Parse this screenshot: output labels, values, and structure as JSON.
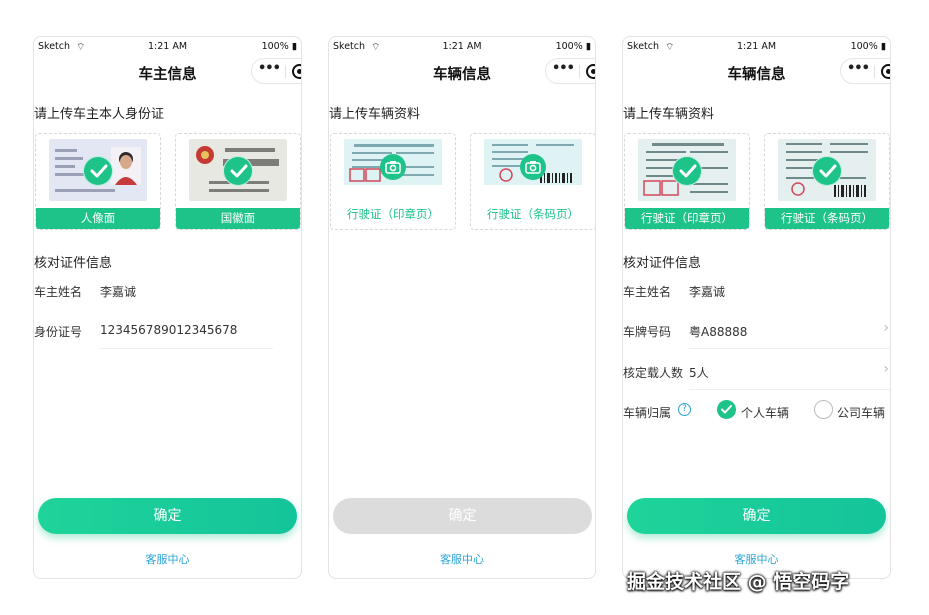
{
  "status_bar": {
    "carrier": "Sketch",
    "time": "1:21 AM",
    "battery": "100%"
  },
  "screens": [
    {
      "title": "车主信息",
      "upload_heading": "请上传车主本人身份证",
      "cards": [
        {
          "label": "人像面",
          "state": "uploaded"
        },
        {
          "label": "国徽面",
          "state": "uploaded"
        }
      ],
      "verify_heading": "核对证件信息",
      "fields": [
        {
          "label": "车主姓名",
          "value": "李嘉诚"
        },
        {
          "label": "身份证号",
          "value": "123456789012345678"
        }
      ],
      "confirm_label": "确定",
      "confirm_enabled": true,
      "service_label": "客服中心"
    },
    {
      "title": "车辆信息",
      "upload_heading": "请上传车辆资料",
      "cards": [
        {
          "label": "行驶证（印章页）",
          "state": "empty"
        },
        {
          "label": "行驶证（条码页）",
          "state": "empty"
        }
      ],
      "confirm_label": "确定",
      "confirm_enabled": false,
      "service_label": "客服中心"
    },
    {
      "title": "车辆信息",
      "upload_heading": "请上传车辆资料",
      "cards": [
        {
          "label": "行驶证（印章页）",
          "state": "uploaded"
        },
        {
          "label": "行驶证（条码页）",
          "state": "uploaded"
        }
      ],
      "verify_heading": "核对证件信息",
      "fields": [
        {
          "label": "车主姓名",
          "value": "李嘉诚"
        },
        {
          "label": "车牌号码",
          "value": "粤A88888"
        },
        {
          "label": "核定载人数",
          "value": "5人"
        }
      ],
      "ownership": {
        "label": "车辆归属",
        "options": [
          "个人车辆",
          "公司车辆"
        ],
        "selected": "个人车辆"
      },
      "confirm_label": "确定",
      "confirm_enabled": true,
      "service_label": "客服中心"
    }
  ],
  "watermark": "掘金技术社区 @ 悟空码字",
  "colors": {
    "accent": "#1ec38a",
    "link": "#2aa3d9",
    "disabled": "#dcdcdc"
  }
}
